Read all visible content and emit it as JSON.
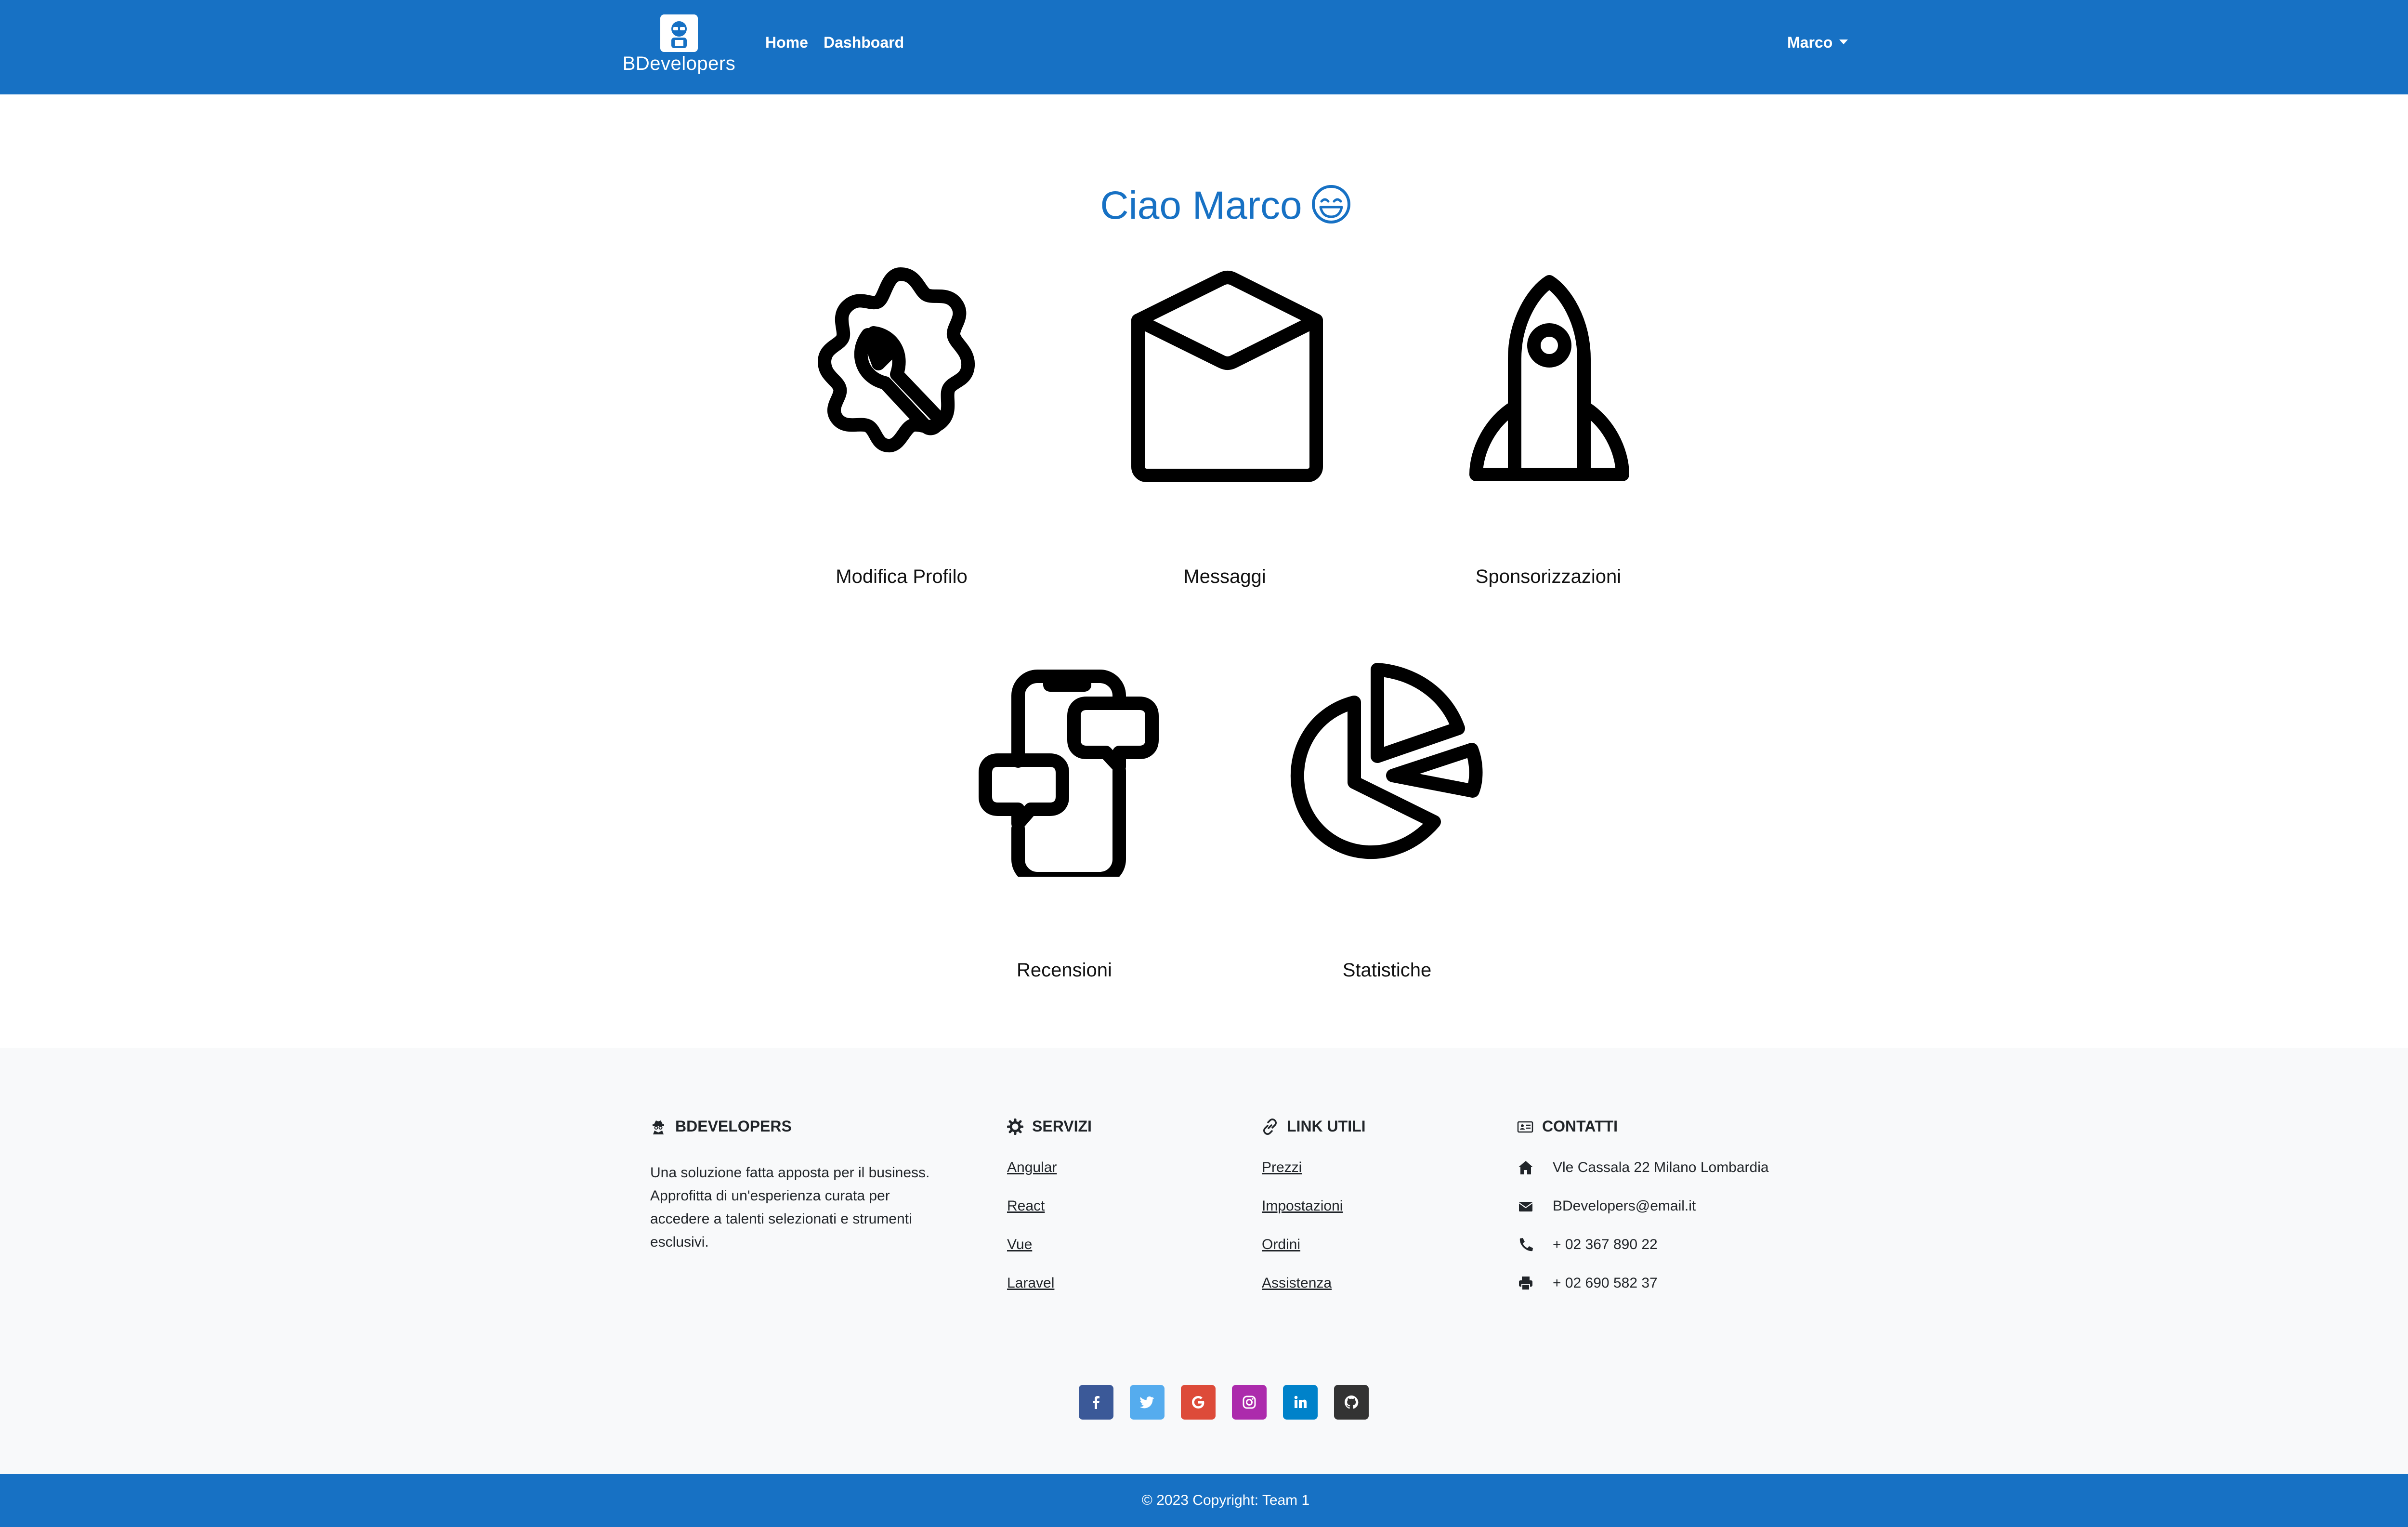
{
  "navbar": {
    "brand_text": "BDevelopers",
    "home": "Home",
    "dashboard": "Dashboard",
    "user": "Marco"
  },
  "greeting": "Ciao Marco",
  "cards": [
    {
      "label": "Modifica Profilo",
      "icon": "settings-gear-wrench-icon"
    },
    {
      "label": "Messaggi",
      "icon": "envelope-icon"
    },
    {
      "label": "Sponsorizzazioni",
      "icon": "rocket-icon"
    },
    {
      "label": "Recensioni",
      "icon": "phone-chat-icon"
    },
    {
      "label": "Statistiche",
      "icon": "pie-chart-icon"
    }
  ],
  "footer": {
    "brand": {
      "title": "BDEVELOPERS",
      "description": "Una soluzione fatta apposta per il business. Approfitta di un'esperienza curata per accedere a talenti selezionati e strumenti esclusivi."
    },
    "services": {
      "title": "SERVIZI",
      "items": [
        "Angular",
        "React",
        "Vue",
        "Laravel"
      ]
    },
    "links": {
      "title": "LINK UTILI",
      "items": [
        "Prezzi",
        "Impostazioni",
        "Ordini",
        "Assistenza"
      ]
    },
    "contacts": {
      "title": "CONTATTI",
      "address": "Vle Cassala 22 Milano Lombardia",
      "email": "BDevelopers@email.it",
      "phone": "+ 02 367 890 22",
      "fax": "+ 02 690 582 37"
    },
    "social": [
      {
        "name": "facebook",
        "color": "#3b5998"
      },
      {
        "name": "twitter",
        "color": "#55acee"
      },
      {
        "name": "google",
        "color": "#dd4b39"
      },
      {
        "name": "instagram",
        "color": "#ac2bac"
      },
      {
        "name": "linkedin",
        "color": "#0082ca"
      },
      {
        "name": "github",
        "color": "#333333"
      }
    ],
    "copyright": "© 2023 Copyright: Team 1"
  },
  "colors": {
    "primary": "#1771c4",
    "footer_bg": "#f8f9fa"
  }
}
